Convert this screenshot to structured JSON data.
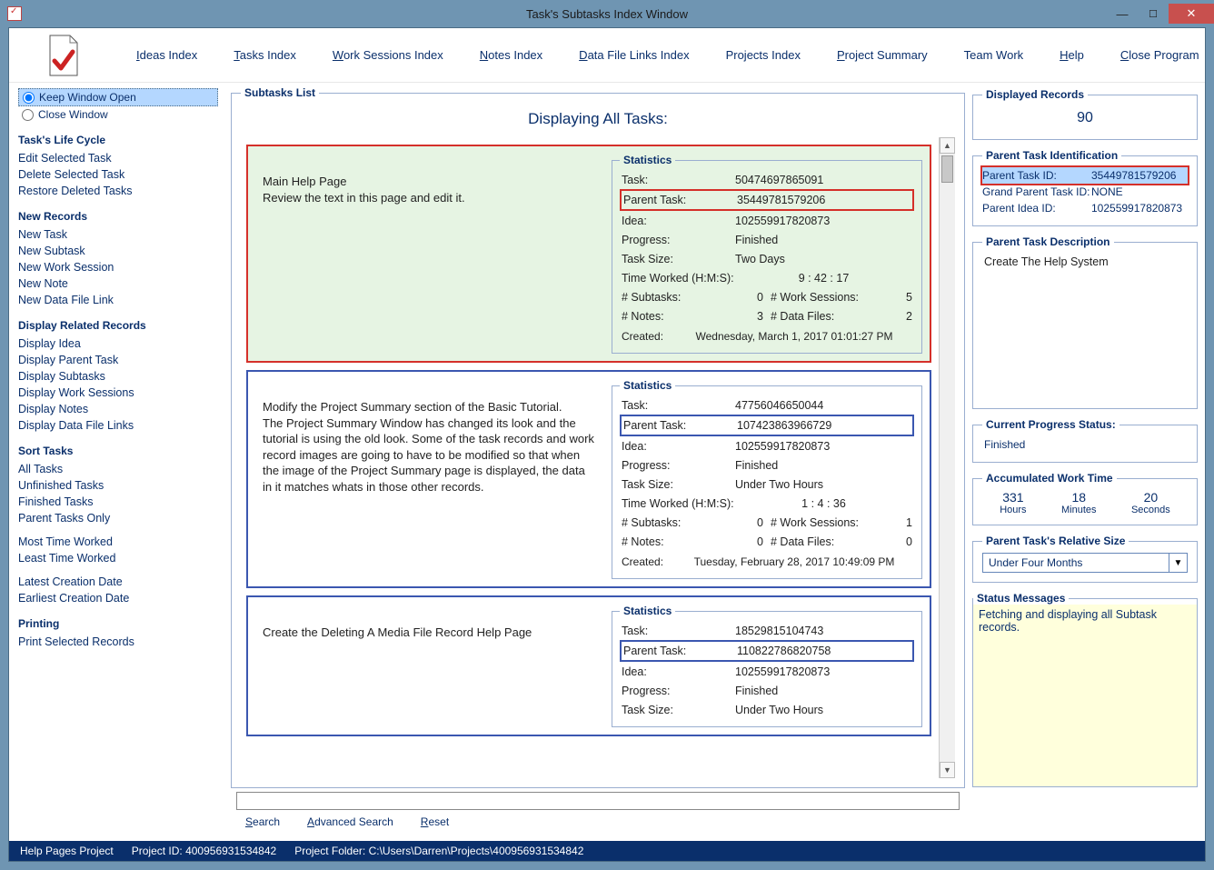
{
  "window": {
    "title": "Task's Subtasks Index Window"
  },
  "menu": {
    "ideas": "Ideas Index",
    "tasks": "Tasks Index",
    "work": "Work Sessions Index",
    "notes": "Notes Index",
    "datafiles": "Data File Links Index",
    "projects": "Projects Index",
    "summary": "Project Summary",
    "team": "Team Work",
    "help": "Help",
    "close": "Close Program"
  },
  "sidebar": {
    "keep_open": "Keep Window Open",
    "close_window": "Close Window",
    "life_cycle_head": "Task's Life Cycle",
    "edit": "Edit Selected Task",
    "delete": "Delete Selected Task",
    "restore": "Restore Deleted Tasks",
    "new_head": "New Records",
    "new_task": "New Task",
    "new_subtask": "New Subtask",
    "new_work": "New Work Session",
    "new_note": "New Note",
    "new_datafile": "New Data File Link",
    "display_head": "Display Related Records",
    "disp_idea": "Display Idea",
    "disp_parent": "Display Parent Task",
    "disp_subtasks": "Display Subtasks",
    "disp_work": "Display Work Sessions",
    "disp_notes": "Display Notes",
    "disp_datafiles": "Display Data File Links",
    "sort_head": "Sort Tasks",
    "all_tasks": "All Tasks",
    "unfinished": "Unfinished Tasks",
    "finished": "Finished Tasks",
    "parent_only": "Parent Tasks Only",
    "most_time": "Most Time Worked",
    "least_time": "Least Time Worked",
    "latest": "Latest Creation Date",
    "earliest": "Earliest Creation Date",
    "print_head": "Printing",
    "print_sel": "Print Selected Records"
  },
  "center": {
    "list_legend": "Subtasks List",
    "heading": "Displaying All Tasks:",
    "stats_legend": "Statistics",
    "labels": {
      "task": "Task:",
      "parent": "Parent Task:",
      "idea": "Idea:",
      "progress": "Progress:",
      "size": "Task Size:",
      "time": "Time Worked (H:M:S):",
      "subtasks": "# Subtasks:",
      "work": "# Work Sessions:",
      "notes": "# Notes:",
      "datafiles": "# Data Files:",
      "created": "Created:"
    },
    "cards": [
      {
        "desc": "Main Help Page\nReview the text in this page and edit it.",
        "task": "50474697865091",
        "parent": "35449781579206",
        "idea": "102559917820873",
        "progress": "Finished",
        "size": "Two Days",
        "time": "9  : 42  : 17",
        "subtasks": "0",
        "work": "5",
        "notes": "3",
        "datafiles": "2",
        "created": "Wednesday, March 1, 2017   01:01:27 PM",
        "hl": "red"
      },
      {
        "desc": "Modify the Project Summary section of the Basic Tutorial.\nThe Project Summary Window has changed its look and the tutorial is using the old look. Some of the task records and work record images are going to have to be modified so that when the image of the Project Summary page is displayed, the data in it matches whats in those other records.",
        "task": "47756046650044",
        "parent": "107423863966729",
        "idea": "102559917820873",
        "progress": "Finished",
        "size": "Under Two Hours",
        "time": "1  :  4  : 36",
        "subtasks": "0",
        "work": "1",
        "notes": "0",
        "datafiles": "0",
        "created": "Tuesday, February 28, 2017   10:49:09 PM",
        "hl": "blue"
      },
      {
        "desc": "Create the Deleting A Media File Record Help Page",
        "task": "18529815104743",
        "parent": "110822786820758",
        "idea": "102559917820873",
        "progress": "Finished",
        "size": "Under Two Hours",
        "time": "",
        "subtasks": "",
        "work": "",
        "notes": "",
        "datafiles": "",
        "created": "",
        "hl": "blue"
      }
    ]
  },
  "right": {
    "displayed_legend": "Displayed Records",
    "displayed_count": "90",
    "ident_legend": "Parent Task Identification",
    "pt_id_lbl": "Parent Task ID:",
    "pt_id": "35449781579206",
    "gp_id_lbl": "Grand Parent Task ID:",
    "gp_id": "NONE",
    "pi_id_lbl": "Parent Idea ID:",
    "pi_id": "102559917820873",
    "desc_legend": "Parent Task Description",
    "desc": "Create The Help System",
    "prog_legend": "Current Progress Status:",
    "prog": "Finished",
    "time_legend": "Accumulated Work Time",
    "hours": "331",
    "hours_u": "Hours",
    "mins": "18",
    "mins_u": "Minutes",
    "secs": "20",
    "secs_u": "Seconds",
    "size_legend": "Parent Task's Relative Size",
    "size_val": "Under Four Months",
    "msgs_legend": "Status Messages",
    "msgs": "Fetching and displaying all Subtask records."
  },
  "search": {
    "search": "Search",
    "adv": "Advanced Search",
    "reset": "Reset"
  },
  "status": {
    "proj_name": "Help Pages Project",
    "proj_id": "Project ID:  400956931534842",
    "proj_folder": "Project Folder:  C:\\Users\\Darren\\Projects\\400956931534842"
  }
}
